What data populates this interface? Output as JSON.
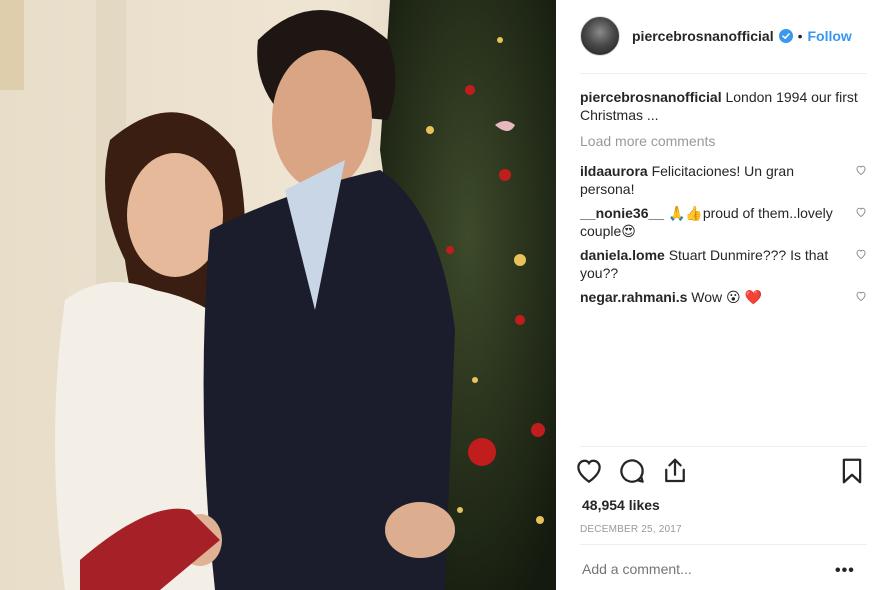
{
  "post": {
    "username": "piercebrosnanofficial",
    "follow_label": "Follow",
    "caption_text": "London 1994 our first Christmas ...",
    "load_more_label": "Load more comments",
    "likes": "48,954 likes",
    "date": "DECEMBER 25, 2017",
    "add_comment_placeholder": "Add a comment...",
    "more_label": "•••",
    "accent_color": "#3897f0"
  },
  "comments": [
    {
      "user": "ildaaurora",
      "text": "Felicitaciones! Un gran persona!"
    },
    {
      "user": "__nonie36__",
      "text": "🙏👍proud of them..lovely couple😍"
    },
    {
      "user": "daniela.lome",
      "text": "Stuart Dunmire??? Is that you??"
    },
    {
      "user": "negar.rahmani.s",
      "text": "Wow 😮 ❤️"
    }
  ],
  "icons": [
    "verified-badge-icon",
    "heart-icon",
    "comment-icon",
    "share-icon",
    "bookmark-icon"
  ]
}
